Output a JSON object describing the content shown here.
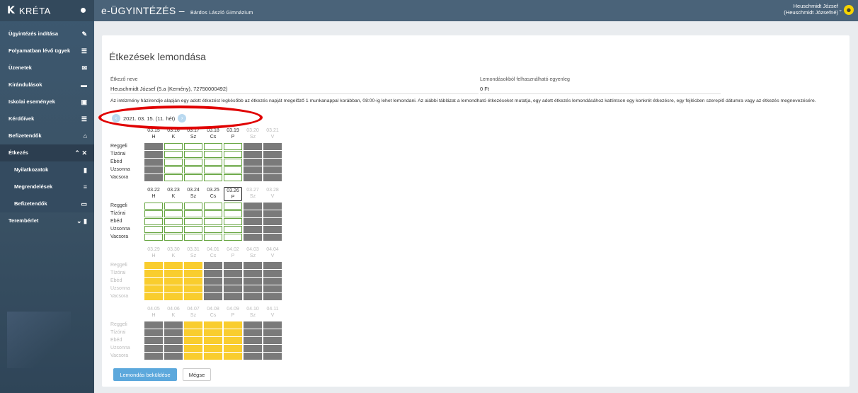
{
  "app": {
    "brand": "KRÉTA",
    "brand_logo": "K",
    "title": "e-ÜGYINTÉZÉS",
    "title_sep": "–",
    "school": "Bárdos László Gimnázium"
  },
  "user": {
    "line1": "Heuschmidt József",
    "line2": "(Heuschmidt Józsefné)"
  },
  "sidebar": {
    "items": [
      {
        "label": "Ügyintézés indítása",
        "icon": "edit-icon"
      },
      {
        "label": "Folyamatban lévő ügyek",
        "icon": "list-icon"
      },
      {
        "label": "Üzenetek",
        "icon": "mail-icon"
      },
      {
        "label": "Kirándulások",
        "icon": "bus-icon"
      },
      {
        "label": "Iskolai események",
        "icon": "calendar-icon"
      },
      {
        "label": "Kérdőívek",
        "icon": "list-icon"
      },
      {
        "label": "Befizetendők",
        "icon": "bank-icon"
      },
      {
        "label": "Étkezés",
        "icon": "cutlery-icon"
      },
      {
        "label": "Nyilatkozatok",
        "icon": "file-icon"
      },
      {
        "label": "Megrendelések",
        "icon": "list-icon"
      },
      {
        "label": "Befizetendők",
        "icon": "card-icon"
      },
      {
        "label": "Terembérlet",
        "icon": "building-icon"
      }
    ]
  },
  "page": {
    "title": "Étkezések lemondása",
    "eater_label": "Étkező neve",
    "eater_value": "Heuschmidt József (5.a (Kemény), 72750000492)",
    "balance_label": "Lemondásokból felhasználható egyenleg",
    "balance_value": "0 Ft",
    "notice": "Az intézmény házirendje alapján egy adott étkezést legkésőbb az étkezés napját megelőző 1 munkanappal korábban, 08:00-ig lehet lemondani. Az alábbi táblázat a lemondható étkezéseket mutatja, egy adott étkezés lemondásához kattintson egy konkrét étkezésre, egy fejlécben szereplő dátumra vagy az étkezés megnevezésére.",
    "week_label": "2021. 03. 15. (11. hét)",
    "send_button": "Lemondás beküldése",
    "cancel_button": "Mégse"
  },
  "meals": [
    "Reggeli",
    "Tízórai",
    "Ebéd",
    "Uzsonna",
    "Vacsora"
  ],
  "weeks": [
    {
      "dates": [
        "03.15",
        "03.16",
        "03.17",
        "03.18",
        "03.19",
        "03.20",
        "03.21"
      ],
      "days": [
        "H",
        "K",
        "Sz",
        "Cs",
        "P",
        "Sz",
        "V"
      ],
      "dim_dates": [
        false,
        false,
        false,
        false,
        false,
        true,
        true
      ],
      "dim_meals": false,
      "selected": -1,
      "cells": [
        "g",
        "o",
        "o",
        "o",
        "o",
        "g",
        "g"
      ]
    },
    {
      "dates": [
        "03.22",
        "03.23",
        "03.24",
        "03.25",
        "03.26",
        "03.27",
        "03.28"
      ],
      "days": [
        "H",
        "K",
        "Sz",
        "Cs",
        "P",
        "Sz",
        "V"
      ],
      "dim_dates": [
        false,
        false,
        false,
        false,
        false,
        true,
        true
      ],
      "dim_meals": false,
      "selected": 4,
      "cells": [
        "o",
        "o",
        "o",
        "o",
        "o",
        "g",
        "g"
      ]
    },
    {
      "dates": [
        "03.29",
        "03.30",
        "03.31",
        "04.01",
        "04.02",
        "04.03",
        "04.04"
      ],
      "days": [
        "H",
        "K",
        "Sz",
        "Cs",
        "P",
        "Sz",
        "V"
      ],
      "dim_dates": [
        true,
        true,
        true,
        true,
        true,
        true,
        true
      ],
      "dim_meals": true,
      "selected": -1,
      "cells": [
        "y",
        "y",
        "y",
        "g",
        "g",
        "g",
        "g"
      ]
    },
    {
      "dates": [
        "04.05",
        "04.06",
        "04.07",
        "04.08",
        "04.09",
        "04.10",
        "04.11"
      ],
      "days": [
        "H",
        "K",
        "Sz",
        "Cs",
        "P",
        "Sz",
        "V"
      ],
      "dim_dates": [
        true,
        true,
        true,
        true,
        true,
        true,
        true
      ],
      "dim_meals": true,
      "selected": -1,
      "cells": [
        "g",
        "g",
        "y",
        "y",
        "y",
        "g",
        "g"
      ]
    }
  ],
  "colors": {
    "cancellable": "#66a540",
    "holiday": "#f9cd2e",
    "unavailable": "#7a7a7a",
    "highlight": "#e00000"
  }
}
